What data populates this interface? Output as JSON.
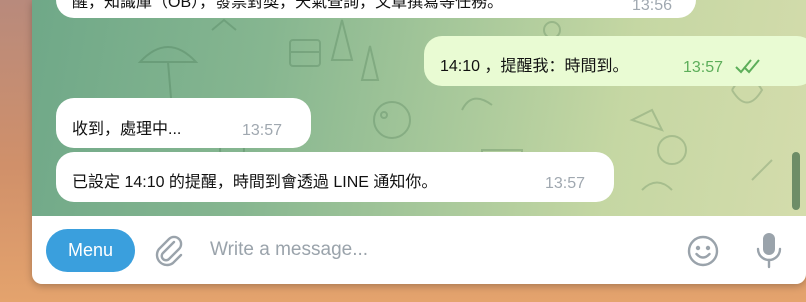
{
  "messages": [
    {
      "text": "醒，知識庫（OB），發票對獎，天氣查詢，文章撰寫等任務。",
      "time": "13:56",
      "direction": "in"
    },
    {
      "text": "14:10 ，提醒我：時間到。",
      "time": "13:57",
      "direction": "out",
      "status_icon": "double-check-icon"
    },
    {
      "text": "收到，處理中...",
      "time": "13:57",
      "direction": "in"
    },
    {
      "text": "已設定 14:10 的提醒，時間到會透過 LINE 通知你。",
      "time": "13:57",
      "direction": "in"
    }
  ],
  "composer": {
    "menu_label": "Menu",
    "input_placeholder": "Write a message...",
    "input_value": ""
  },
  "colors": {
    "accent": "#3a9fdd",
    "outgoing_bubble": "#e9fbd3",
    "outgoing_time": "#5dae5a",
    "incoming_time": "#a0a8b0"
  },
  "icons": {
    "attach": "paperclip-icon",
    "emoji": "smiley-icon",
    "mic": "microphone-icon"
  }
}
